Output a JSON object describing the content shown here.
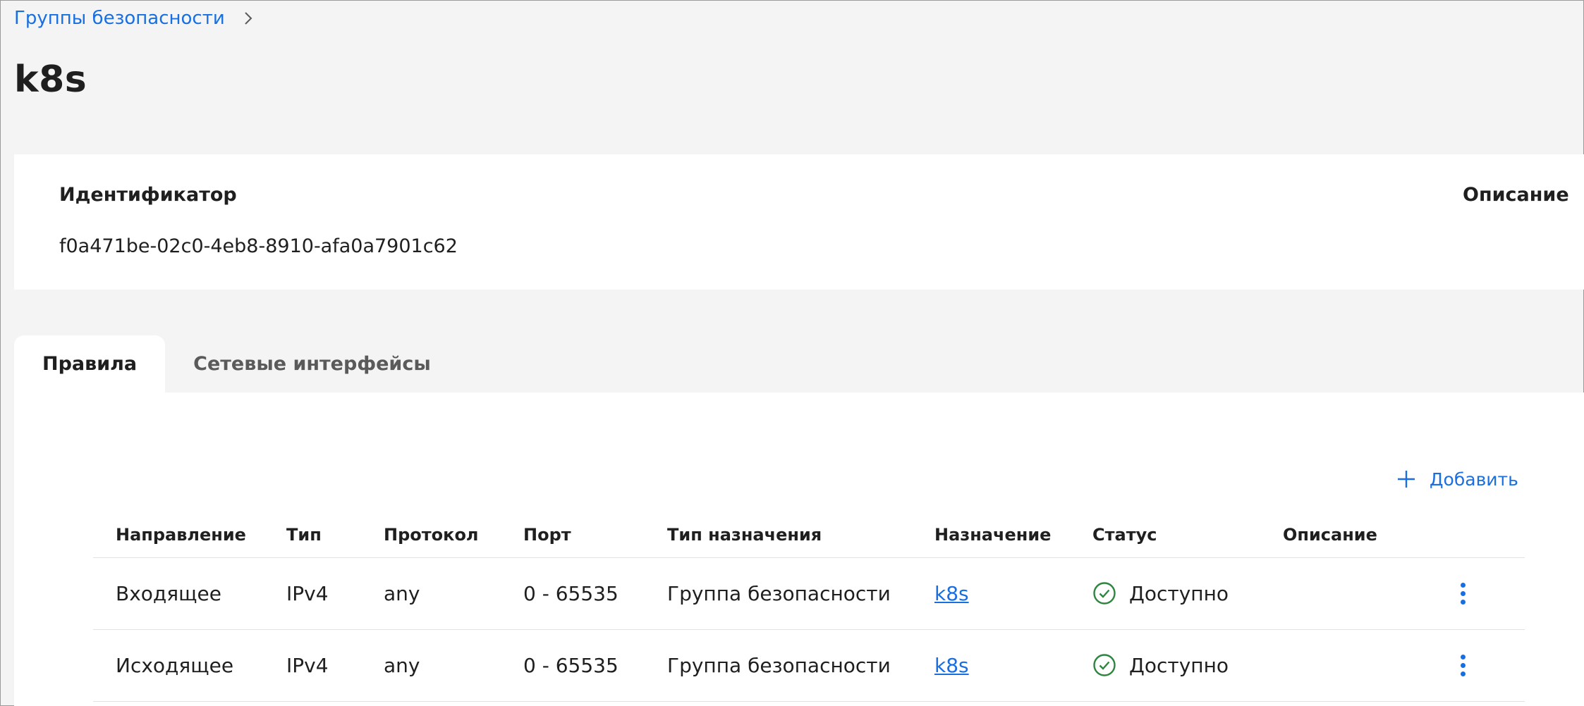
{
  "breadcrumb": {
    "parent": "Группы безопасности"
  },
  "page": {
    "title": "k8s"
  },
  "info": {
    "id_label": "Идентификатор",
    "id_value": "f0a471be-02c0-4eb8-8910-afa0a7901c62",
    "description_label": "Описание"
  },
  "tabs": [
    {
      "label": "Правила",
      "active": true
    },
    {
      "label": "Сетевые интерфейсы",
      "active": false
    }
  ],
  "toolbar": {
    "add_label": "Добавить"
  },
  "table": {
    "columns": [
      "Направление",
      "Тип",
      "Протокол",
      "Порт",
      "Тип назначения",
      "Назначение",
      "Статус",
      "Описание"
    ],
    "rows": [
      {
        "direction": "Входящее",
        "type": "IPv4",
        "protocol": "any",
        "port": "0 - 65535",
        "dest_type": "Группа безопасности",
        "destination": "k8s",
        "status": "Доступно",
        "description": ""
      },
      {
        "direction": "Исходящее",
        "type": "IPv4",
        "protocol": "any",
        "port": "0 - 65535",
        "dest_type": "Группа безопасности",
        "destination": "k8s",
        "status": "Доступно",
        "description": ""
      }
    ]
  },
  "colors": {
    "accent": "#1a6fe0",
    "status_ok": "#2e8540"
  }
}
